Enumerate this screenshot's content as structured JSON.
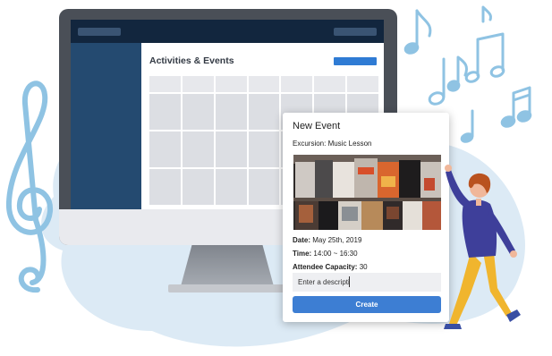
{
  "screen": {
    "title": "Activities & Events"
  },
  "event_card": {
    "heading": "New Event",
    "subtitle": "Excursion: Music Lesson",
    "image_name": "vinyl-records-photo",
    "date_label": "Date:",
    "date_value": " May 25th, 2019",
    "time_label": "Time:",
    "time_value": " 14:00 ~ 16:30",
    "capacity_label": "Attendee Capacity:",
    "capacity_value": " 30",
    "description_value": "Enter a descripti",
    "create_label": "Create"
  },
  "colors": {
    "accent": "#3d7ed3",
    "screen_dark": "#17314f",
    "sidebar": "#244a70",
    "blob": "#dceaf5",
    "music_notes": "#8fc3e3"
  },
  "decorations": {
    "clef_icon": "treble-clef-icon",
    "notes_icon": "music-notes-icon",
    "person_name": "person-illustration"
  }
}
